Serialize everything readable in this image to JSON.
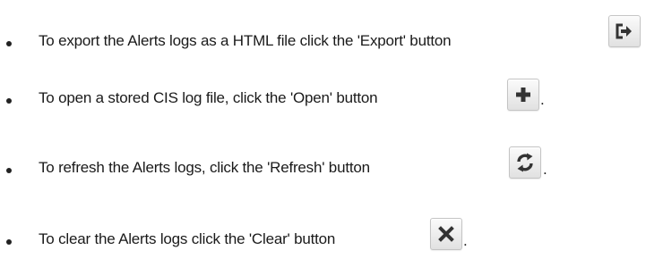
{
  "items": [
    {
      "text": "To export the Alerts  logs as a HTML file click the 'Export' button",
      "button_icon": "export-icon",
      "trailing": ""
    },
    {
      "text": "To open a stored CIS log file, click the 'Open' button",
      "button_icon": "plus-icon",
      "trailing": "."
    },
    {
      "text": "To refresh the Alerts logs, click the 'Refresh' button",
      "button_icon": "refresh-icon",
      "trailing": "."
    },
    {
      "text": "To clear the Alerts logs click the 'Clear' button",
      "button_icon": "close-icon",
      "trailing": "."
    }
  ],
  "colors": {
    "icon": "#333333",
    "button_border": "#c4c4c4",
    "text": "#1a1a1a"
  }
}
